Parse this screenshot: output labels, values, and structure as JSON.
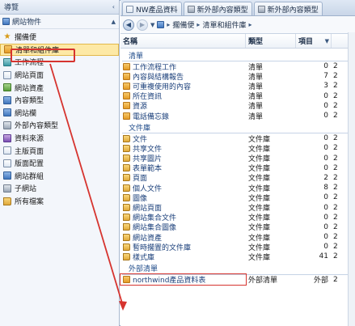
{
  "nav": {
    "header": "導覽",
    "section": "網站物件",
    "items": [
      {
        "label": "擱備便",
        "icon": "star-icon"
      },
      {
        "label": "清單和組件庫",
        "icon": "list-library-icon",
        "selected": true
      },
      {
        "label": "工作流程",
        "icon": "workflow-icon"
      },
      {
        "label": "網站頁面",
        "icon": "site-pages-icon"
      },
      {
        "label": "網站資產",
        "icon": "site-assets-icon"
      },
      {
        "label": "內容類型",
        "icon": "content-types-icon"
      },
      {
        "label": "網站欄",
        "icon": "site-columns-icon"
      },
      {
        "label": "外部內容類型",
        "icon": "external-content-icon"
      },
      {
        "label": "資料來源",
        "icon": "data-source-icon"
      },
      {
        "label": "主版頁面",
        "icon": "master-page-icon"
      },
      {
        "label": "版面配置",
        "icon": "page-layout-icon"
      },
      {
        "label": "網站群組",
        "icon": "site-groups-icon"
      },
      {
        "label": "子網站",
        "icon": "subsites-icon"
      },
      {
        "label": "所有檔案",
        "icon": "all-files-icon"
      }
    ]
  },
  "tabs": [
    {
      "label": "NW產品資料",
      "active": false
    },
    {
      "label": "新外部內容類型",
      "active": false
    },
    {
      "label": "新外部內容類型",
      "active": false
    }
  ],
  "breadcrumb": {
    "home_label": "擱備便",
    "current_label": "清單和組件庫"
  },
  "columns": {
    "name": "名稱",
    "type": "類型",
    "items": "項目",
    "extra": ""
  },
  "groups": [
    {
      "label": "清單",
      "rows": [
        {
          "name": "工作流程工作",
          "type": "清單",
          "items": "0",
          "extra": "2"
        },
        {
          "name": "內容與結構報告",
          "type": "清單",
          "items": "7",
          "extra": "2"
        },
        {
          "name": "可重複使用的內容",
          "type": "清單",
          "items": "3",
          "extra": "2"
        },
        {
          "name": "所在資訊",
          "type": "清單",
          "items": "0",
          "extra": "2"
        },
        {
          "name": "資源",
          "type": "清單",
          "items": "0",
          "extra": "2"
        },
        {
          "name": "電話備忘錄",
          "type": "清單",
          "items": "0",
          "extra": "2"
        }
      ]
    },
    {
      "label": "文件庫",
      "rows": [
        {
          "name": "文件",
          "type": "文件庫",
          "items": "0",
          "extra": "2"
        },
        {
          "name": "共享文件",
          "type": "文件庫",
          "items": "0",
          "extra": "2"
        },
        {
          "name": "共享圖片",
          "type": "文件庫",
          "items": "0",
          "extra": "2"
        },
        {
          "name": "表單範本",
          "type": "文件庫",
          "items": "0",
          "extra": "2"
        },
        {
          "name": "頁面",
          "type": "文件庫",
          "items": "2",
          "extra": "2"
        },
        {
          "name": "個人文件",
          "type": "文件庫",
          "items": "8",
          "extra": "2"
        },
        {
          "name": "圖像",
          "type": "文件庫",
          "items": "0",
          "extra": "2"
        },
        {
          "name": "網站頁面",
          "type": "文件庫",
          "items": "0",
          "extra": "2"
        },
        {
          "name": "網站集合文件",
          "type": "文件庫",
          "items": "0",
          "extra": "2"
        },
        {
          "name": "網站集合圖像",
          "type": "文件庫",
          "items": "0",
          "extra": "2"
        },
        {
          "name": "網站資產",
          "type": "文件庫",
          "items": "0",
          "extra": "2"
        },
        {
          "name": "暫時擱置的文件庫",
          "type": "文件庫",
          "items": "0",
          "extra": "2"
        },
        {
          "name": "樣式庫",
          "type": "文件庫",
          "items": "41",
          "extra": "2"
        }
      ]
    },
    {
      "label": "外部清單",
      "rows": [
        {
          "name": "northwind產品資料表",
          "type": "外部清單",
          "items": "外部",
          "extra": "2",
          "highlight": true
        }
      ]
    }
  ],
  "colors": {
    "accent": "#1f4b8a",
    "selected_bg": "#fde9a6",
    "annotation": "#d6342f"
  }
}
